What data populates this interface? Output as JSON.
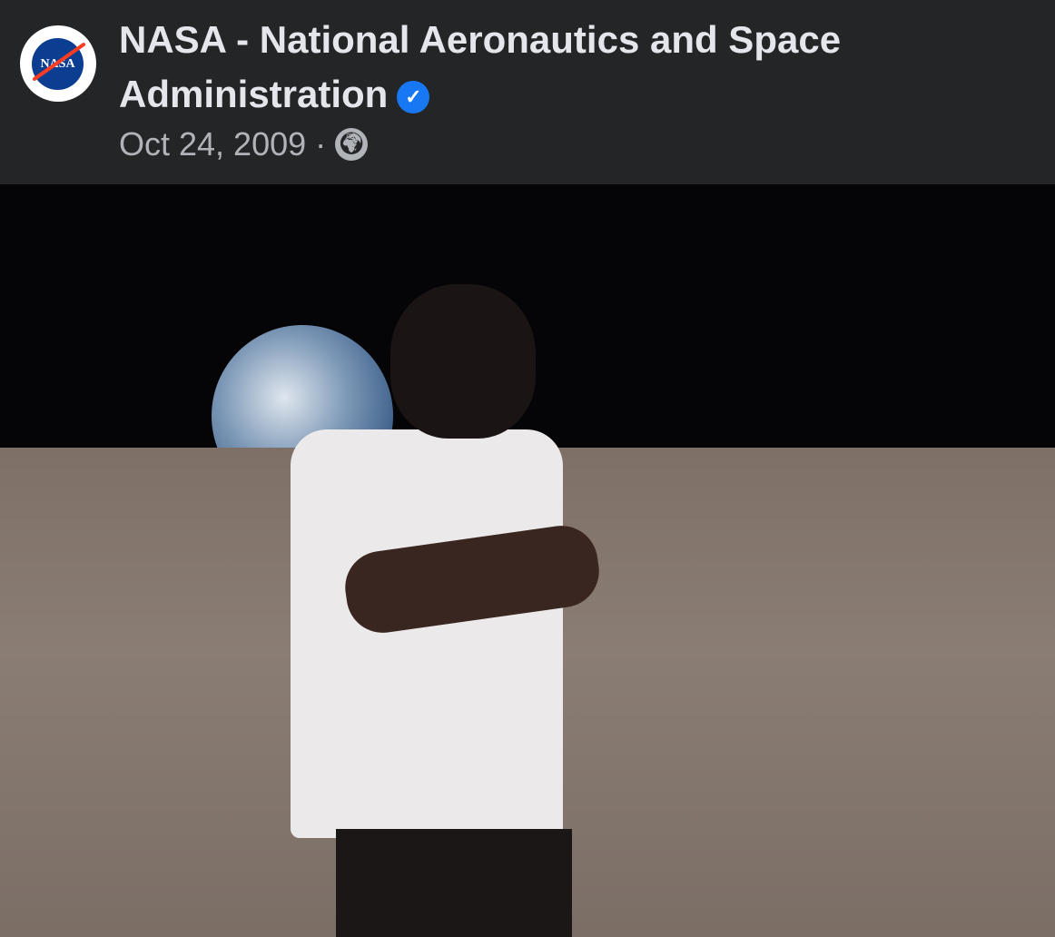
{
  "post": {
    "author": "NASA - National Aeronautics and Space Administration",
    "verified_icon": "verified-badge-icon",
    "date": "Oct 24, 2009",
    "separator": "·",
    "audience_icon": "globe-icon",
    "avatar_logo_text": "NASA"
  },
  "colors": {
    "background": "#242527",
    "verified": "#1877f2",
    "text": "#e4e6eb",
    "meta": "#b0b3b8"
  }
}
